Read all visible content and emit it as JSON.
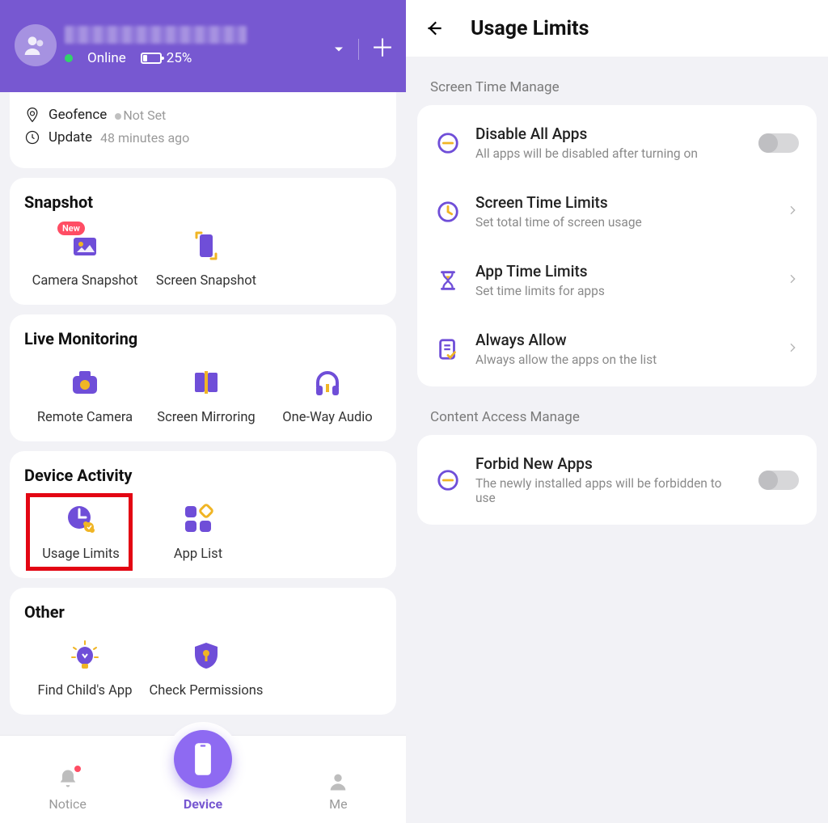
{
  "left": {
    "header": {
      "status_text": "Online",
      "battery_pct": "25%"
    },
    "info": {
      "geofence_label": "Geofence",
      "geofence_status": "Not Set",
      "update_label": "Update",
      "update_value": "48 minutes ago"
    },
    "sections": {
      "snapshot": {
        "title": "Snapshot",
        "items": [
          {
            "label": "Camera Snapshot",
            "badge": "New"
          },
          {
            "label": "Screen Snapshot"
          }
        ]
      },
      "live": {
        "title": "Live Monitoring",
        "items": [
          {
            "label": "Remote Camera"
          },
          {
            "label": "Screen Mirroring"
          },
          {
            "label": "One-Way Audio"
          }
        ]
      },
      "activity": {
        "title": "Device Activity",
        "items": [
          {
            "label": "Usage Limits",
            "highlighted": true
          },
          {
            "label": "App List"
          }
        ]
      },
      "other": {
        "title": "Other",
        "items": [
          {
            "label": "Find Child's App"
          },
          {
            "label": "Check Permissions"
          }
        ]
      }
    },
    "nav": {
      "notice": "Notice",
      "device": "Device",
      "me": "Me"
    }
  },
  "right": {
    "title": "Usage Limits",
    "sections": [
      {
        "label": "Screen Time Manage",
        "rows": [
          {
            "title": "Disable All Apps",
            "sub": "All apps will be disabled after turning on",
            "type": "toggle",
            "on": false
          },
          {
            "title": "Screen Time Limits",
            "sub": "Set total time of screen usage",
            "type": "nav"
          },
          {
            "title": "App Time Limits",
            "sub": "Set time limits for apps",
            "type": "nav"
          },
          {
            "title": "Always Allow",
            "sub": "Always allow the apps on the list",
            "type": "nav"
          }
        ]
      },
      {
        "label": "Content Access Manage",
        "rows": [
          {
            "title": "Forbid New Apps",
            "sub": "The newly installed apps will be forbidden to use",
            "type": "toggle",
            "on": false
          }
        ]
      }
    ]
  }
}
